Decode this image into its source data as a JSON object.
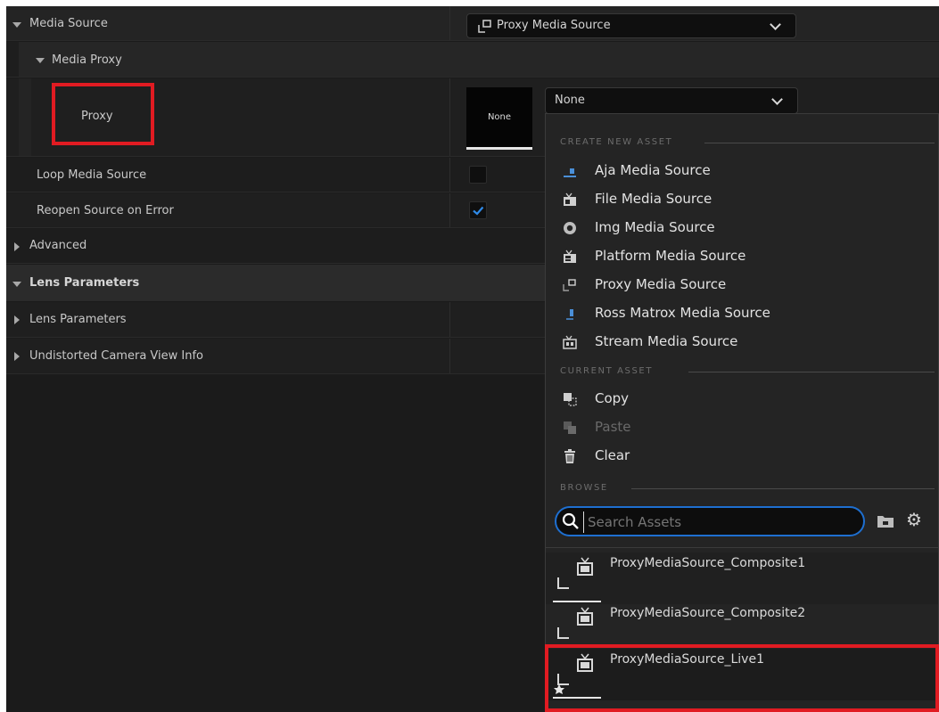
{
  "details": {
    "media_source": {
      "label": "Media Source",
      "value": "Proxy Media Source"
    },
    "media_proxy": {
      "label": "Media Proxy"
    },
    "proxy": {
      "label": "Proxy",
      "thumb_label": "None",
      "value": "None"
    },
    "loop_media_source": {
      "label": "Loop Media Source",
      "checked": false
    },
    "reopen_on_error": {
      "label": "Reopen Source on Error",
      "checked": true
    },
    "advanced": {
      "label": "Advanced"
    },
    "lens_parameters_section": {
      "label": "Lens Parameters"
    },
    "lens_parameters": {
      "label": "Lens Parameters"
    },
    "undistorted_view": {
      "label": "Undistorted Camera View Info"
    }
  },
  "picker": {
    "create_new_asset": {
      "heading": "CREATE NEW ASSET",
      "items": [
        {
          "label": "Aja Media Source",
          "icon": "aja-icon"
        },
        {
          "label": "File Media Source",
          "icon": "file-media-icon"
        },
        {
          "label": "Img Media Source",
          "icon": "img-media-icon"
        },
        {
          "label": "Platform Media Source",
          "icon": "platform-media-icon"
        },
        {
          "label": "Proxy Media Source",
          "icon": "proxy-media-icon"
        },
        {
          "label": "Ross Matrox Media Source",
          "icon": "ross-matrox-icon"
        },
        {
          "label": "Stream Media Source",
          "icon": "stream-media-icon"
        }
      ]
    },
    "current_asset": {
      "heading": "CURRENT ASSET",
      "items": [
        {
          "label": "Copy",
          "icon": "copy-icon",
          "enabled": true
        },
        {
          "label": "Paste",
          "icon": "paste-icon",
          "enabled": false
        },
        {
          "label": "Clear",
          "icon": "trash-icon",
          "enabled": true
        }
      ]
    },
    "browse": {
      "heading": "BROWSE",
      "search_placeholder": "Search Assets",
      "assets": [
        {
          "name": "ProxyMediaSource_Composite1"
        },
        {
          "name": "ProxyMediaSource_Composite2"
        },
        {
          "name": "ProxyMediaSource_Live1"
        }
      ]
    }
  },
  "colors": {
    "highlight": "#e11b22",
    "accent": "#1e6fd0",
    "background": "#1b1b1b"
  }
}
